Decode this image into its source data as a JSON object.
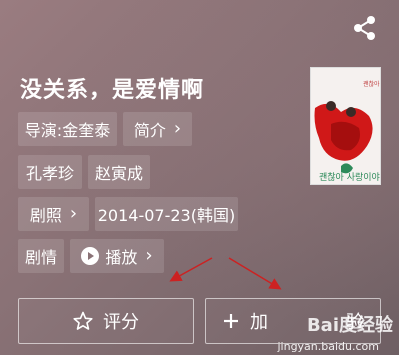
{
  "movie": {
    "title": "没关系，是爱情啊",
    "director": "导演:金奎泰",
    "intro_label": "简介",
    "cast": [
      "孔孝珍",
      "赵寅成"
    ],
    "stills_label": "剧照",
    "release": "2014-07-23(韩国)",
    "plot_label": "剧情",
    "play_label": "播放"
  },
  "actions": {
    "rate_label": "评分",
    "add_label": "加",
    "add_suffix": "验"
  },
  "watermark": {
    "brand": "Bai度经验",
    "url": "jingyan.baidu.com"
  },
  "colors": {
    "arrow": "#cc2222",
    "poster_dress": "#d01818"
  },
  "icons": {
    "share": "share-icon",
    "chevron": "chevron-right-icon",
    "play": "play-circle-icon",
    "star": "star-outline-icon",
    "plus": "plus-icon"
  }
}
